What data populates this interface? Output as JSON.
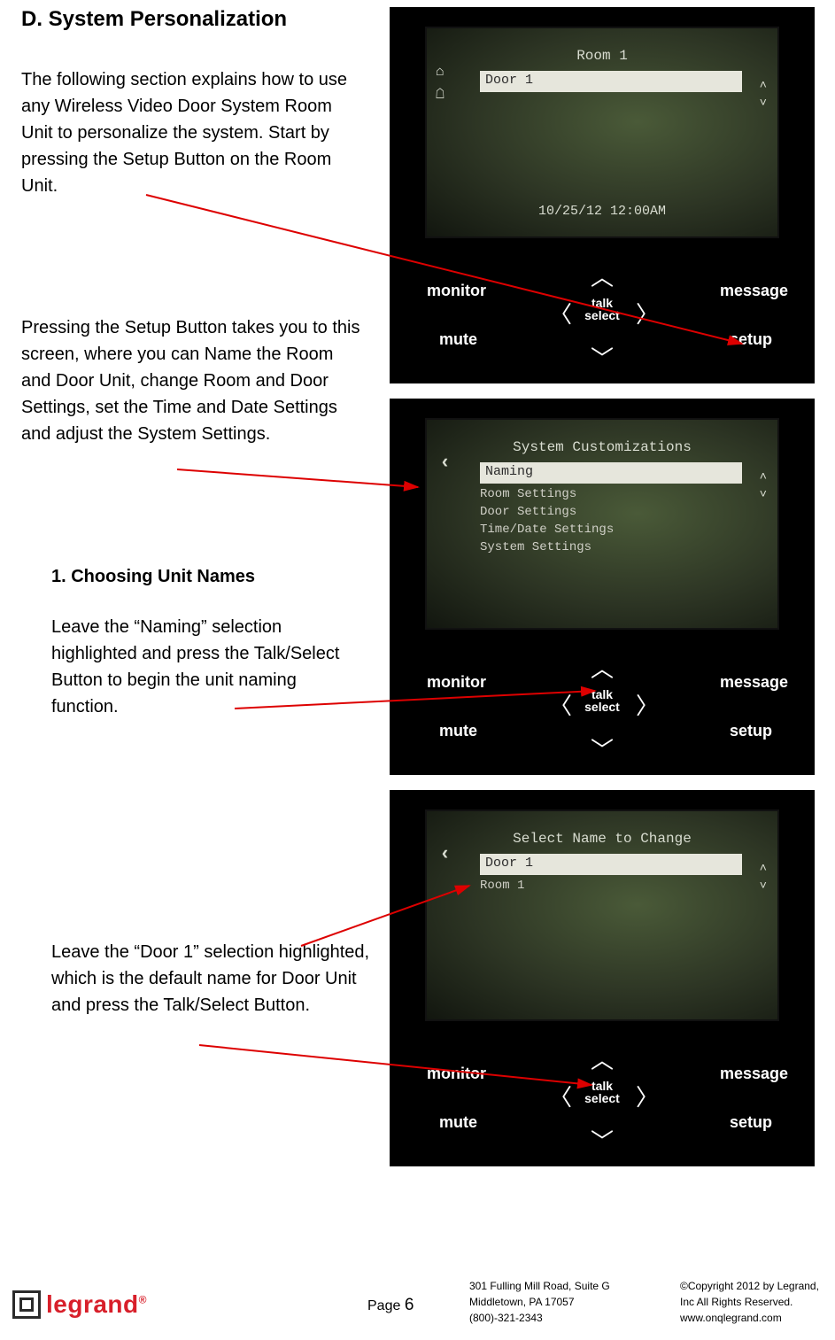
{
  "heading": "D.  System Personalization",
  "para1": "The following section explains how to use any Wireless Video Door System Room Unit to personalize the system. Start by pressing the Setup Button on the Room Unit.",
  "para2": "Pressing the Setup Button takes you to this screen, where you can Name the Room and Door Unit, change Room and Door Settings, set the Time and Date Settings and adjust the System Settings.",
  "subhead": "1. Choosing Unit Names",
  "para3": "Leave the “Naming” selection highlighted and press the Talk/Select Button to begin the unit naming function.",
  "para4": "Leave the “Door 1” selection highlighted, which is the default name for Door Unit and press the Talk/Select Button.",
  "brand": "legrand",
  "dpad": {
    "monitor": "monitor",
    "mute": "mute",
    "message": "message",
    "setup": "setup",
    "talk1": "talk",
    "talk2": "select"
  },
  "screen1": {
    "title": "Room 1",
    "field": "Door 1",
    "datetime": "10/25/12 12:00AM"
  },
  "screen2": {
    "title": "System Customizations",
    "highlight": "Naming",
    "lines": [
      "Room Settings",
      "Door Settings",
      "Time/Date Settings",
      "System Settings"
    ]
  },
  "screen3": {
    "title": "Select Name to Change",
    "highlight": "Door 1",
    "lines": [
      "Room 1"
    ]
  },
  "footer": {
    "logo": "legrand",
    "page_label": "Page ",
    "page_num": "6",
    "addr1": "301 Fulling Mill Road, Suite G",
    "addr2": "Middletown, PA   17057",
    "addr3": "(800)-321-2343",
    "cpy1": "©Copyright 2012 by Legrand,",
    "cpy2": "Inc All Rights Reserved.",
    "cpy3": "www.onqlegrand.com"
  }
}
